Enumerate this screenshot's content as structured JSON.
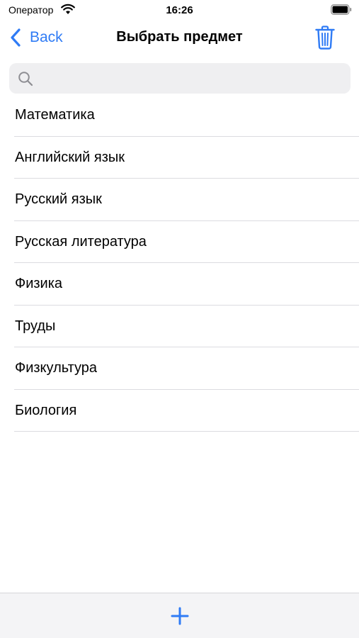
{
  "status_bar": {
    "carrier": "Оператор",
    "time": "16:26",
    "icons": [
      "wifi-icon",
      "battery-icon"
    ]
  },
  "nav": {
    "back_label": "Back",
    "title": "Выбрать предмет",
    "trash_icon": "trash-icon"
  },
  "search": {
    "value": "",
    "placeholder": "",
    "icon": "magnifier-icon"
  },
  "subjects": [
    {
      "label": "Математика"
    },
    {
      "label": "Английский язык"
    },
    {
      "label": "Русский язык"
    },
    {
      "label": "Русская литература"
    },
    {
      "label": "Физика"
    },
    {
      "label": "Труды"
    },
    {
      "label": "Физкультура"
    },
    {
      "label": "Биология"
    }
  ],
  "toolbar": {
    "add_icon": "plus-icon"
  },
  "colors": {
    "accent": "#2f7bf5",
    "search_bg": "#efeff1",
    "separator": "#dcdce0",
    "toolbar_bg": "#f4f4f6"
  }
}
